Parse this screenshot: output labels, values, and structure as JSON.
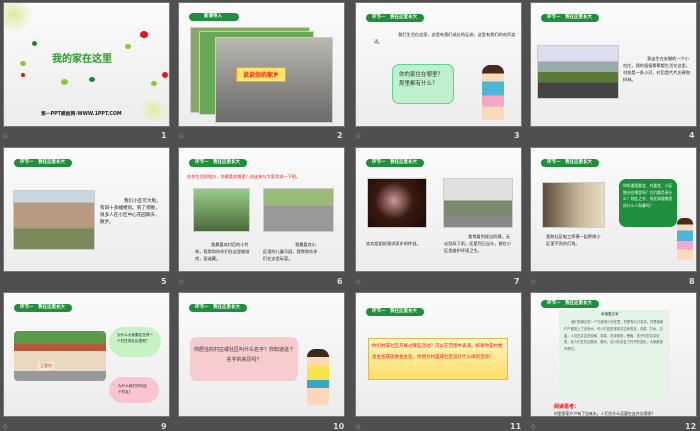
{
  "section_pill": "环节一　我在这里长大",
  "slides": [
    {
      "number": "1",
      "title": "我的家在这里",
      "footer": "第一PPT模板网-WWW.1PPT.COM"
    },
    {
      "number": "2",
      "pill": "新课导入",
      "banner": "说说你的家乡"
    },
    {
      "number": "3",
      "text": "我们生活在这里，这里有我们成长的足迹，这里有我们的欢声笑语。",
      "bubble": "你的家住在哪里？那里都有什么？"
    },
    {
      "number": "4",
      "text": "我出生在安徽的一个小村庄，我的祖祖辈辈都生活在这里。村前是一条小河，村后是片片庄稼和树林。"
    },
    {
      "number": "5",
      "text": "我们小区可大啦，有四十多幢楼房。到了傍晚，很多人在小区中心花园聊天、散步。"
    },
    {
      "number": "6",
      "prompt": "在你生活的地方，你最喜欢哪里？说出来与大家交流一下吧。",
      "caption_left": "我最喜欢村后的小竹林，我常和伙伴们在这里做游戏，捉迷藏。",
      "caption_right": "我最喜欢小区里的儿童乐园，我常和伙伴们在这里玩耍。"
    },
    {
      "number": "7",
      "caption_left": "欢欢姐姐给我讲家乡的传说。",
      "caption_right": "我常看到保洁阿姨，无论刮风下雨，还是烈日当头，都在小区里维护环境卫生。"
    },
    {
      "number": "8",
      "caption": "我和社区电工师傅一起更换小区里不亮的灯泡。",
      "bubble": "你知道居委会、村委会、小区物业在哪里吗？它们都负责什么？除此之外，你还知道哪里的什么人和事吗？"
    },
    {
      "number": "9",
      "cloud1": "为什么大家要住在同一个村庄或社区里呢？",
      "cloud2": "为什么我们村叫这个村名？",
      "sign": "王家村"
    },
    {
      "number": "10",
      "bubble": "你居住的村庄或社区叫什么名字？你知道这个名字的来历吗？"
    },
    {
      "number": "11",
      "box": "你们村或社区开展过哪些活动？可以在范围中表演。如果你是村委会主任或居委会主任，你想为村里或社区设计什么样的活动？"
    },
    {
      "number": "12",
      "article_title": "幸福搬迁家",
      "article": "我们的家住在一个古老的小村庄里，村里有几口老井。村里家家户户都用上了自来水，可人们还是常到井边来洗衣、洗菜、打水。清晨，人们在井边洗衣服、择菜、说说家常；傍晚，孩子们在井边玩耍，老人们在井边乘凉、聊天。这口井见证了村子的变化，大家都舍不得它。",
      "question_label": "阅读思考：",
      "question": "村里家家户户有了自来水，人们为什么还要在这井边用呢？"
    }
  ]
}
